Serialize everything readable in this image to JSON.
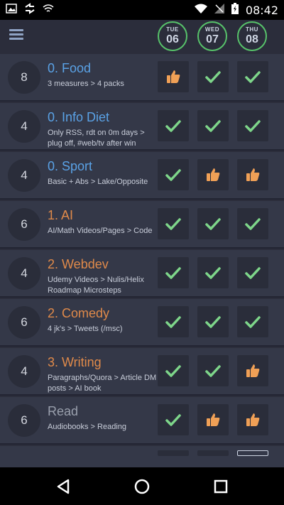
{
  "status": {
    "time": "08:42"
  },
  "header": {
    "days": [
      {
        "name": "TUE",
        "date": "06"
      },
      {
        "name": "WED",
        "date": "07"
      },
      {
        "name": "THU",
        "date": "08"
      }
    ]
  },
  "colors": {
    "orange": "#e08a4a",
    "blue": "#5aa2e6",
    "gray": "#9aa0ad",
    "check": "#7ed68a",
    "thumb": "#f0a056"
  },
  "habits": [
    {
      "count": "8",
      "title": "0. Food",
      "color": "blue",
      "sub": "3 measures > 4 packs",
      "marks": [
        "thumb",
        "check",
        "check"
      ]
    },
    {
      "count": "4",
      "title": "0. Info Diet",
      "color": "blue",
      "sub": "Only RSS, rdt on 0m days > plug off, #web/tv after win",
      "marks": [
        "check",
        "check",
        "check"
      ]
    },
    {
      "count": "4",
      "title": "0. Sport",
      "color": "blue",
      "sub": "Basic + Abs > Lake/Opposite",
      "marks": [
        "check",
        "thumb",
        "thumb"
      ]
    },
    {
      "count": "6",
      "title": "1. AI",
      "color": "orange",
      "sub": "AI/Math Videos/Pages > Code",
      "marks": [
        "check",
        "check",
        "check"
      ]
    },
    {
      "count": "4",
      "title": "2. Webdev",
      "color": "orange",
      "sub": "Udemy Videos > Nulis/Helix Roadmap Microsteps",
      "marks": [
        "check",
        "check",
        "check"
      ]
    },
    {
      "count": "6",
      "title": "2. Comedy",
      "color": "orange",
      "sub": "4 jk's > Tweets (/msc)",
      "marks": [
        "check",
        "check",
        "check"
      ]
    },
    {
      "count": "4",
      "title": "3. Writing",
      "color": "orange",
      "sub": "Paragraphs/Quora > Article DM posts > AI book",
      "marks": [
        "check",
        "check",
        "thumb"
      ]
    },
    {
      "count": "6",
      "title": "Read",
      "color": "gray",
      "sub": "Audiobooks > Reading",
      "marks": [
        "check",
        "thumb",
        "thumb"
      ]
    }
  ]
}
